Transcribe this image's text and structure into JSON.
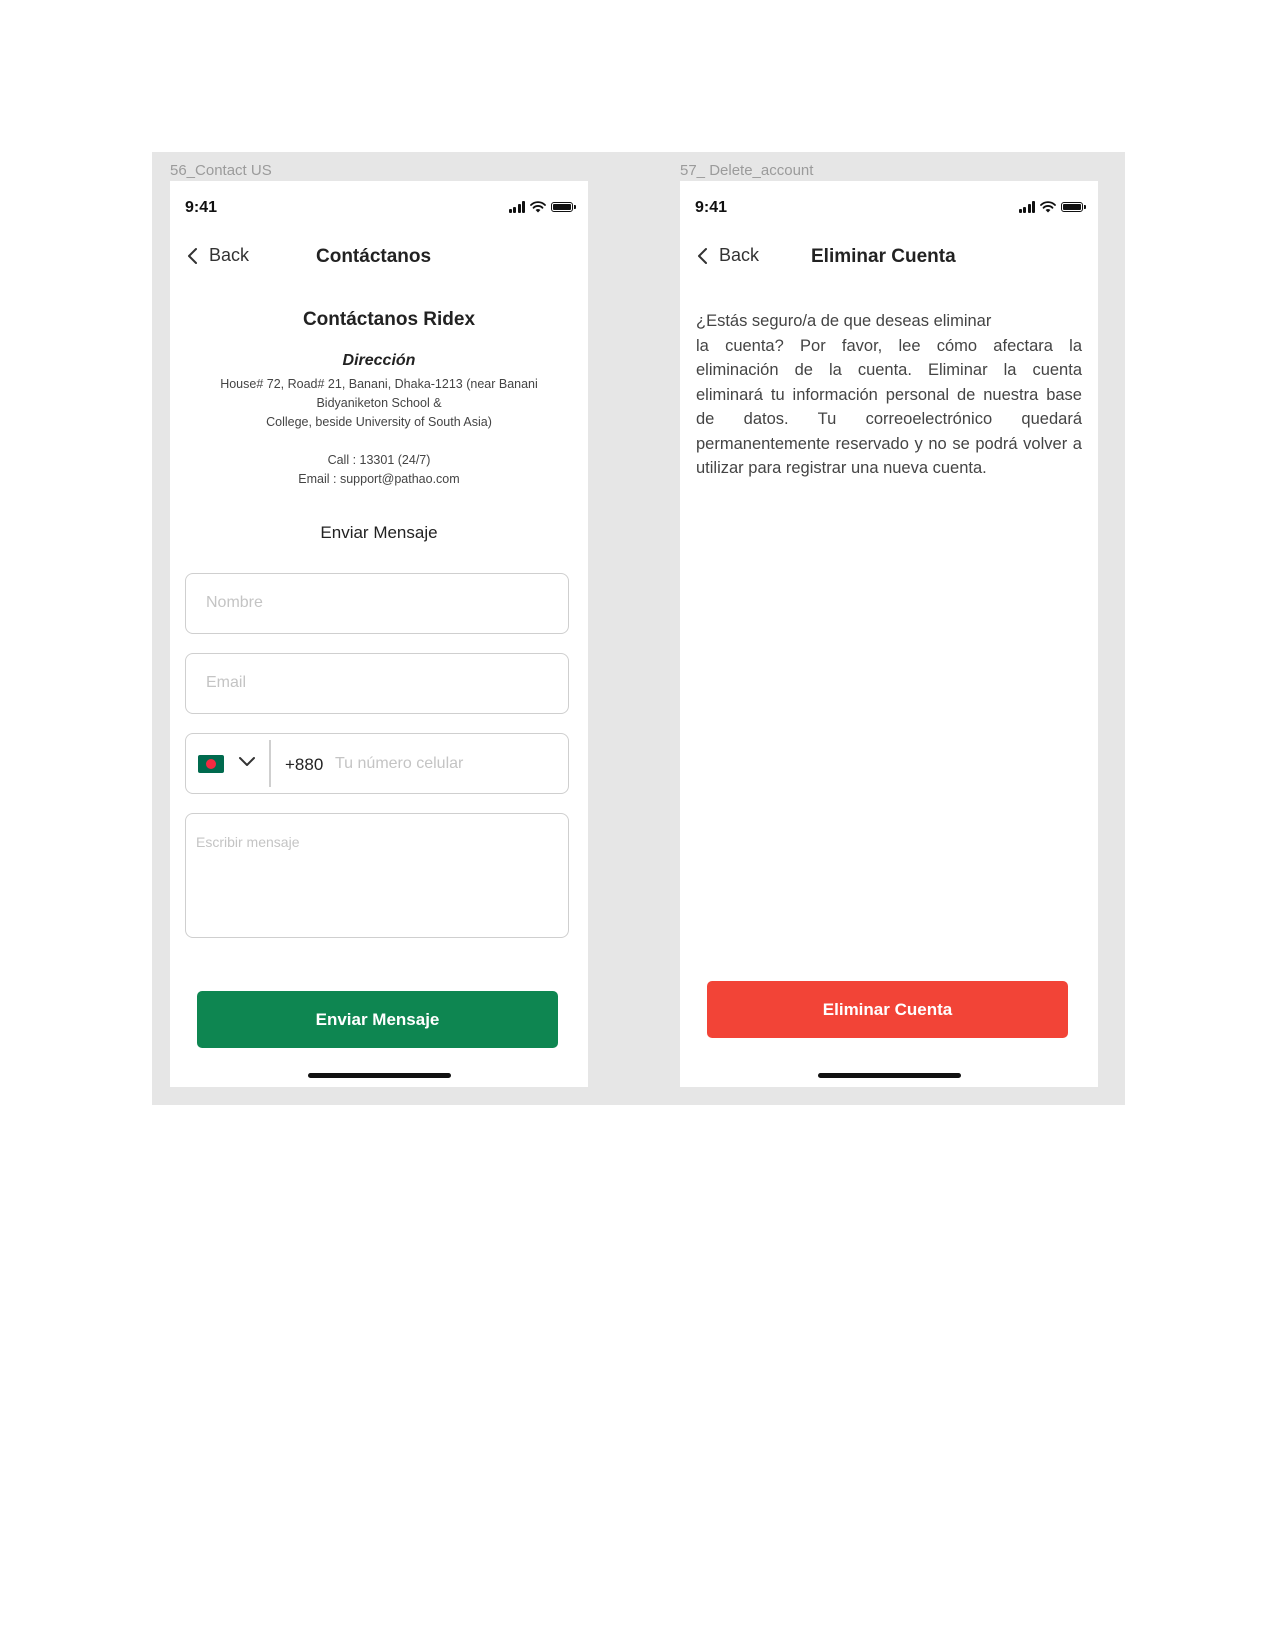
{
  "screens": [
    {
      "frame_label": "56_Contact US",
      "status": {
        "time": "9:41"
      },
      "nav": {
        "back_label": "Back",
        "title": "Contáctanos"
      },
      "heading": "Contáctanos Ridex",
      "address_title": "Dirección",
      "address_lines": [
        "House# 72, Road# 21, Banani, Dhaka-1213 (near Banani",
        "Bidyaniketon School &",
        "College, beside University of South Asia)"
      ],
      "call": "Call : 13301 (24/7)",
      "email": "Email : support@pathao.com",
      "form_title": "Enviar Mensaje",
      "fields": {
        "name_placeholder": "Nombre",
        "email_placeholder": "Email",
        "country_code": "+880",
        "phone_placeholder": "Tu número celular",
        "message_placeholder": "Escribir mensaje"
      },
      "submit_label": "Enviar Mensaje"
    },
    {
      "frame_label": "57_ Delete_account",
      "status": {
        "time": "9:41"
      },
      "nav": {
        "back_label": "Back",
        "title": "Eliminar Cuenta"
      },
      "body_first_line": "¿Estás seguro/a de que deseas eliminar",
      "body": "la cuenta? Por favor, lee cómo afectara la eliminación de la cuenta. Eliminar la cuenta eliminará tu información personal de nuestra base de datos. Tu correoelectrónico quedará permanentemente reservado y no se podrá volver a utilizar para registrar una nueva cuenta.",
      "delete_label": "Eliminar Cuenta"
    }
  ],
  "colors": {
    "primary_green": "#0e8651",
    "danger_red": "#f24437",
    "canvas_gray": "#e6e6e6"
  },
  "icons": [
    "signal-icon",
    "wifi-icon",
    "battery-icon",
    "chevron-left-icon",
    "bangladesh-flag-icon",
    "chevron-down-icon"
  ]
}
